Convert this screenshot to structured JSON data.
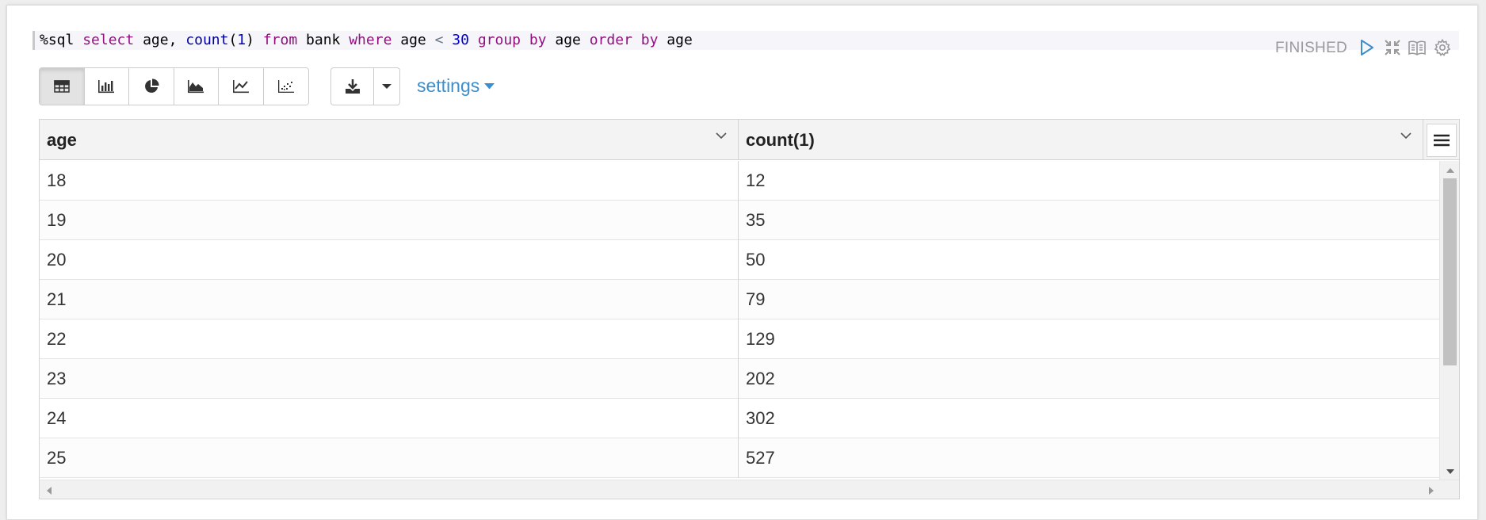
{
  "paragraph": {
    "status": "FINISHED",
    "code": {
      "interpreter": "%sql",
      "tokens": [
        {
          "t": "select",
          "c": "kw"
        },
        {
          "t": " age, ",
          "c": ""
        },
        {
          "t": "count",
          "c": "fn"
        },
        {
          "t": "(",
          "c": ""
        },
        {
          "t": "1",
          "c": "num"
        },
        {
          "t": ") ",
          "c": ""
        },
        {
          "t": "from",
          "c": "kw"
        },
        {
          "t": " bank ",
          "c": ""
        },
        {
          "t": "where",
          "c": "kw"
        },
        {
          "t": " age ",
          "c": ""
        },
        {
          "t": "<",
          "c": "op"
        },
        {
          "t": " ",
          "c": ""
        },
        {
          "t": "30",
          "c": "num"
        },
        {
          "t": " ",
          "c": ""
        },
        {
          "t": "group",
          "c": "kw"
        },
        {
          "t": " ",
          "c": ""
        },
        {
          "t": "by",
          "c": "kw"
        },
        {
          "t": " age ",
          "c": ""
        },
        {
          "t": "order",
          "c": "kw"
        },
        {
          "t": " ",
          "c": ""
        },
        {
          "t": "by",
          "c": "kw"
        },
        {
          "t": " age",
          "c": ""
        }
      ]
    },
    "controls": [
      "play-icon",
      "collapse-icon",
      "book-icon",
      "gear-icon"
    ]
  },
  "toolbar": {
    "chart_types": [
      {
        "icon": "table-icon",
        "active": true
      },
      {
        "icon": "bar-chart-icon",
        "active": false
      },
      {
        "icon": "pie-chart-icon",
        "active": false
      },
      {
        "icon": "area-chart-icon",
        "active": false
      },
      {
        "icon": "line-chart-icon",
        "active": false
      },
      {
        "icon": "scatter-chart-icon",
        "active": false
      }
    ],
    "download_icon": "download-icon",
    "settings_label": "settings"
  },
  "grid": {
    "columns": [
      "age",
      "count(1)"
    ],
    "rows": [
      [
        "18",
        "12"
      ],
      [
        "19",
        "35"
      ],
      [
        "20",
        "50"
      ],
      [
        "21",
        "79"
      ],
      [
        "22",
        "129"
      ],
      [
        "23",
        "202"
      ],
      [
        "24",
        "302"
      ],
      [
        "25",
        "527"
      ]
    ]
  },
  "colors": {
    "accent": "#3d8ecb",
    "keyword": "#930f80",
    "number": "#0000cd",
    "status": "#9a9a9a"
  }
}
